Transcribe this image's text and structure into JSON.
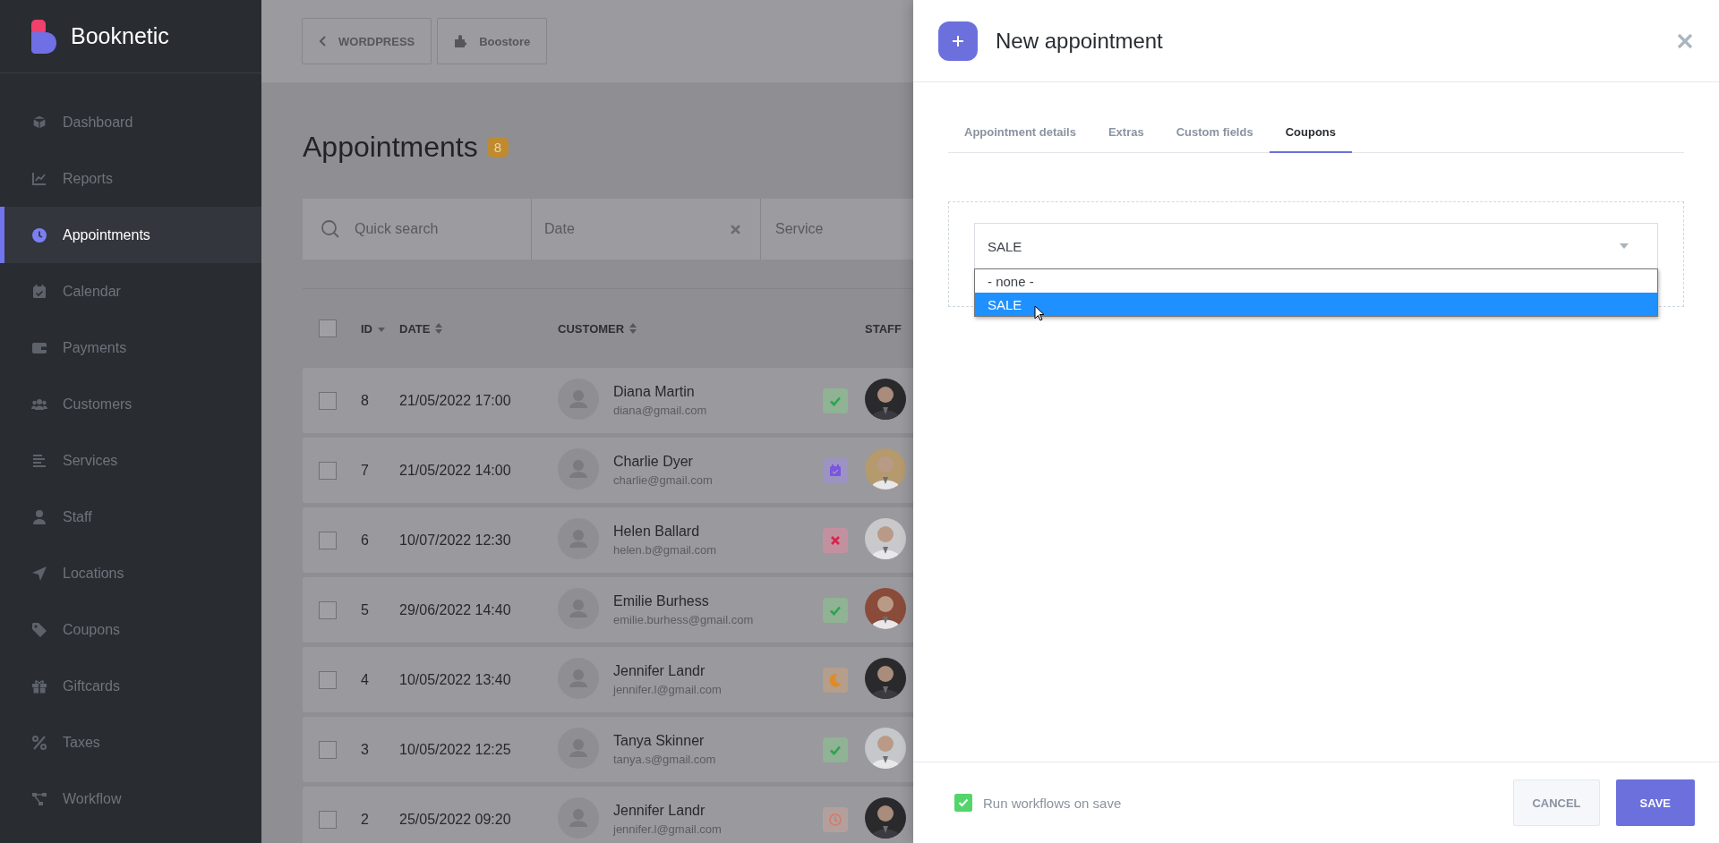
{
  "sidebar": {
    "brand": "Booknetic",
    "items": [
      {
        "label": "Dashboard",
        "selected": false
      },
      {
        "label": "Reports",
        "selected": false
      },
      {
        "label": "Appointments",
        "selected": true
      },
      {
        "label": "Calendar",
        "selected": false
      },
      {
        "label": "Payments",
        "selected": false
      },
      {
        "label": "Customers",
        "selected": false
      },
      {
        "label": "Services",
        "selected": false
      },
      {
        "label": "Staff",
        "selected": false
      },
      {
        "label": "Locations",
        "selected": false
      },
      {
        "label": "Coupons",
        "selected": false
      },
      {
        "label": "Giftcards",
        "selected": false
      },
      {
        "label": "Taxes",
        "selected": false
      },
      {
        "label": "Workflow",
        "selected": false
      }
    ]
  },
  "top_buttons": [
    {
      "label": "WORDPRESS",
      "kind": "back"
    },
    {
      "label": "Boostore",
      "kind": "store"
    }
  ],
  "page": {
    "title": "Appointments",
    "count": "8"
  },
  "filters": {
    "search_placeholder": "Quick search",
    "date_placeholder": "Date",
    "service_placeholder": "Service"
  },
  "table": {
    "select_all_checked": false,
    "columns": [
      "ID",
      "DATE",
      "CUSTOMER",
      "STAFF"
    ],
    "rows": [
      {
        "id": "8",
        "date": "21/05/2022 17:00",
        "name": "Diana Martin",
        "email": "diana@gmail.com",
        "kind": "approved",
        "checked": false
      },
      {
        "id": "7",
        "date": "21/05/2022 14:00",
        "name": "Charlie Dyer",
        "email": "charlie@gmail.com",
        "kind": "scheduled",
        "checked": false
      },
      {
        "id": "6",
        "date": "10/07/2022 12:30",
        "name": "Helen Ballard",
        "email": "helen.b@gmail.com",
        "kind": "canceled",
        "checked": false
      },
      {
        "id": "5",
        "date": "29/06/2022 14:40",
        "name": "Emilie Burhess",
        "email": "emilie.burhess@gmail.com",
        "kind": "approved",
        "checked": false
      },
      {
        "id": "4",
        "date": "10/05/2022 13:40",
        "name": "Jennifer Landr",
        "email": "jennifer.l@gmail.com",
        "kind": "waiting",
        "checked": false
      },
      {
        "id": "3",
        "date": "10/05/2022 12:25",
        "name": "Tanya Skinner",
        "email": "tanya.s@gmail.com",
        "kind": "approved",
        "checked": false
      },
      {
        "id": "2",
        "date": "25/05/2022 09:20",
        "name": "Jennifer Landr",
        "email": "jennifer.l@gmail.com",
        "kind": "pending",
        "checked": false
      }
    ]
  },
  "panel": {
    "title": "New appointment",
    "tabs": [
      {
        "label": "Appointment details",
        "selected": false
      },
      {
        "label": "Extras",
        "selected": false
      },
      {
        "label": "Custom fields",
        "selected": false
      },
      {
        "label": "Coupons",
        "selected": true
      }
    ],
    "coupon_select": {
      "value": "SALE",
      "options": [
        {
          "label": "- none -",
          "selected": false
        },
        {
          "label": "SALE",
          "selected": true
        }
      ]
    },
    "run_workflows": {
      "label": "Run workflows on save",
      "checked": true
    },
    "buttons": [
      {
        "label": "CANCEL",
        "kind": "secondary"
      },
      {
        "label": "SAVE",
        "kind": "primary"
      }
    ]
  }
}
